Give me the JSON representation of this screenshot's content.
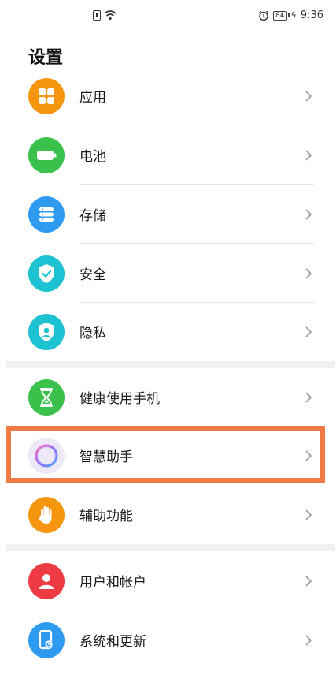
{
  "status_bar": {
    "time": "9:36",
    "battery_level": "84"
  },
  "page_title": "设置",
  "items": [
    {
      "label": "应用",
      "icon": "apps-icon",
      "color": "#f5960e"
    },
    {
      "label": "电池",
      "icon": "battery-icon",
      "color": "#39c14b"
    },
    {
      "label": "存储",
      "icon": "storage-icon",
      "color": "#2f9bf0"
    },
    {
      "label": "安全",
      "icon": "shield-check-icon",
      "color": "#1cc2d2"
    },
    {
      "label": "隐私",
      "icon": "privacy-icon",
      "color": "#1cc2d2"
    },
    {
      "label": "健康使用手机",
      "icon": "hourglass-icon",
      "color": "#39c14b"
    },
    {
      "label": "智慧助手",
      "icon": "smart-assistant-icon",
      "color": "#ece8f6"
    },
    {
      "label": "辅助功能",
      "icon": "hand-icon",
      "color": "#f5960e"
    },
    {
      "label": "用户和帐户",
      "icon": "user-icon",
      "color": "#ee3b43"
    },
    {
      "label": "系统和更新",
      "icon": "phone-settings-icon",
      "color": "#2f9bf0"
    }
  ],
  "highlight_color": "#f07a46"
}
